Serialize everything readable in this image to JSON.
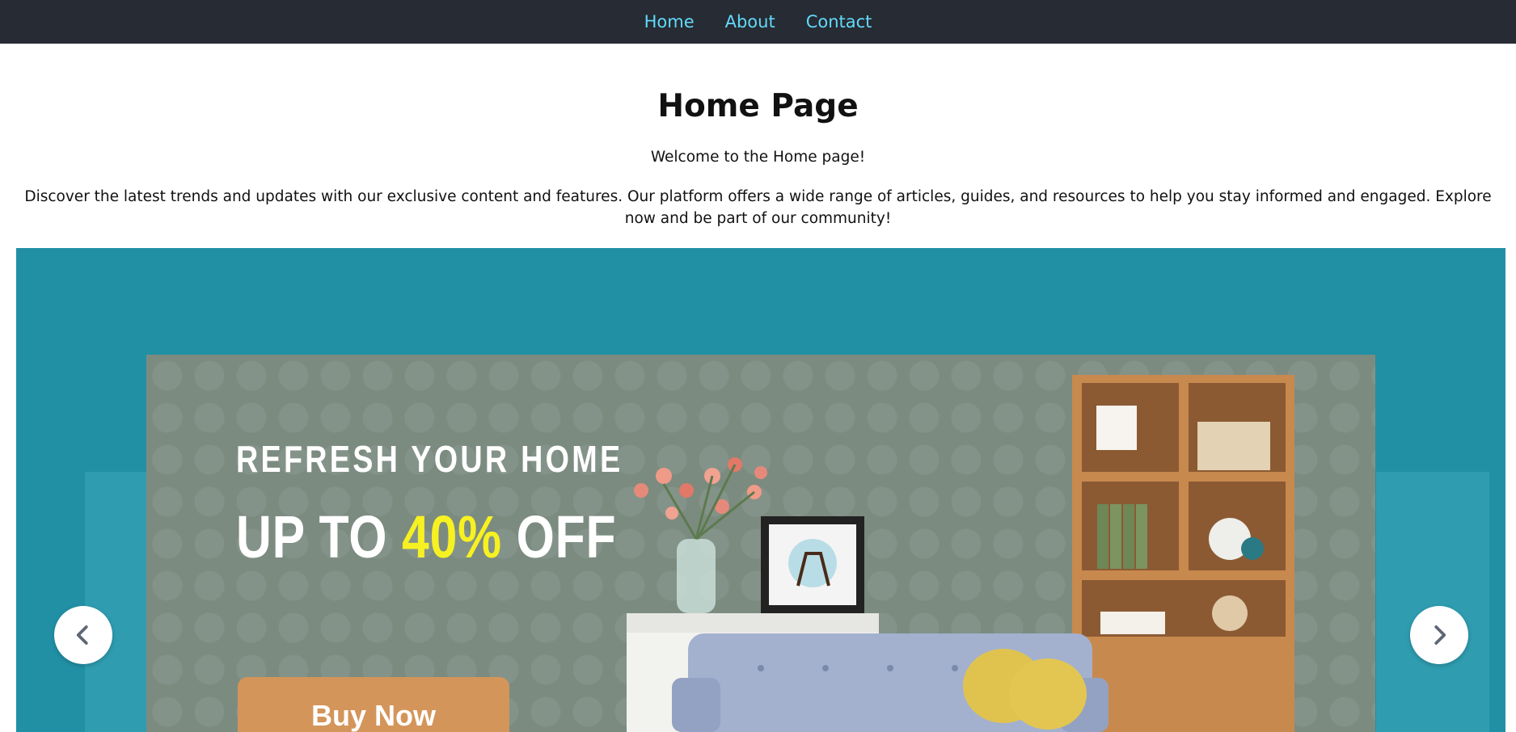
{
  "nav": {
    "items": [
      "Home",
      "About",
      "Contact"
    ]
  },
  "main": {
    "title": "Home Page",
    "welcome": "Welcome to the Home page!",
    "intro": "Discover the latest trends and updates with our exclusive content and features. Our platform offers a wide range of articles, guides, and resources to help you stay informed and engaged. Explore now and be part of our community!"
  },
  "carousel": {
    "slide": {
      "kicker": "REFRESH YOUR HOME",
      "offer_prefix": "UP TO ",
      "offer_highlight": "40%",
      "offer_suffix": " OFF",
      "button_label": "Buy Now"
    },
    "prev_icon": "chevron-left-icon",
    "next_icon": "chevron-right-icon"
  },
  "colors": {
    "navbar_bg": "#272b33",
    "nav_link": "#61dafb",
    "carousel_bg": "#2190a5",
    "banner_bg": "#7b8b80",
    "offer_highlight": "#f7f122",
    "button_bg": "#d4955a"
  }
}
